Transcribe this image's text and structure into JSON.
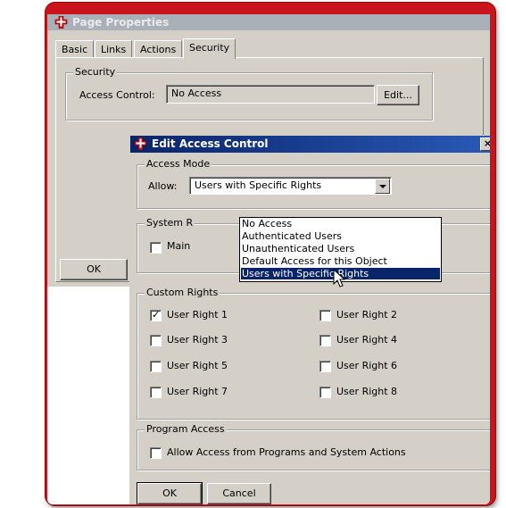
{
  "page_properties": {
    "title": "Page Properties",
    "tabs": [
      {
        "label": "Basic",
        "active": false
      },
      {
        "label": "Links",
        "active": false
      },
      {
        "label": "Actions",
        "active": false
      },
      {
        "label": "Security",
        "active": true
      }
    ],
    "security_group": "Security",
    "access_control_label": "Access Control:",
    "access_control_value": "No Access",
    "edit_button": "Edit...",
    "ok_button": "OK"
  },
  "edit_access_control": {
    "title": "Edit Access Control",
    "close_label": "×",
    "access_mode": {
      "group": "Access Mode",
      "allow_label": "Allow:",
      "selected": "Users with Specific Rights",
      "options": [
        "No Access",
        "Authenticated Users",
        "Unauthenticated Users",
        "Default Access for this Object",
        "Users with Specific Rights"
      ],
      "highlighted_index": 4
    },
    "system_rights": {
      "group_visible": "System R",
      "checkbox_label_visible": "Main",
      "checked": false
    },
    "custom_rights": {
      "group": "Custom Rights",
      "items": [
        {
          "label": "User Right 1",
          "checked": true
        },
        {
          "label": "User Right 2",
          "checked": false
        },
        {
          "label": "User Right 3",
          "checked": false
        },
        {
          "label": "User Right 4",
          "checked": false
        },
        {
          "label": "User Right 5",
          "checked": false
        },
        {
          "label": "User Right 6",
          "checked": false
        },
        {
          "label": "User Right 7",
          "checked": false
        },
        {
          "label": "User Right 8",
          "checked": false
        }
      ]
    },
    "program_access": {
      "group": "Program Access",
      "checkbox_label": "Allow Access from Programs and System Actions",
      "checked": false
    },
    "ok_button": "OK",
    "cancel_button": "Cancel"
  },
  "icons": {
    "app_logo": "red-cross-logo-icon",
    "cursor": "arrow-cursor-icon"
  },
  "colors": {
    "frame": "#c8141a",
    "dialog_face": "#d4d0c8",
    "active_title": "#0a246a",
    "inactive_title": "#aab0b8",
    "selection": "#0a246a"
  }
}
